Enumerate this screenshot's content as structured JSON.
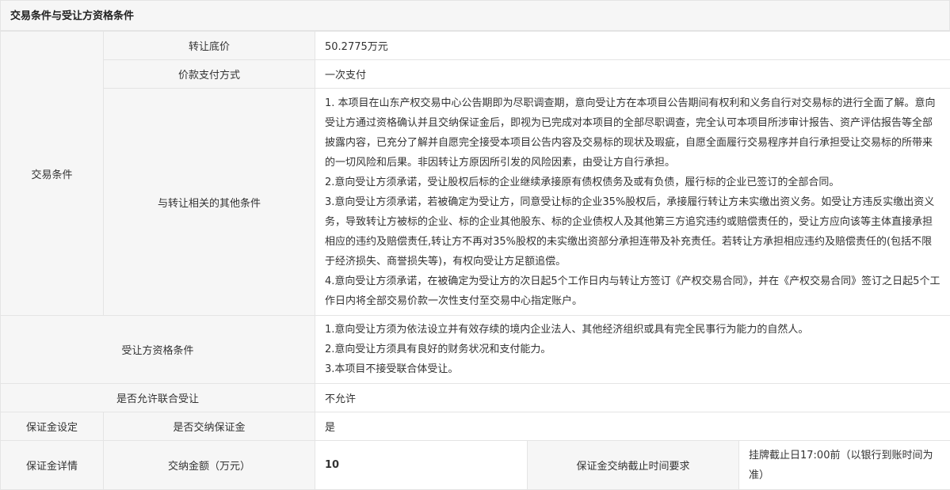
{
  "section_title": "交易条件与受让方资格条件",
  "trade": {
    "group_label": "交易条件",
    "price_label": "转让底价",
    "price_value": "50.2775万元",
    "payment_label": "价款支付方式",
    "payment_value": "一次支付",
    "other_label": "与转让相关的其他条件",
    "other_paragraphs": [
      "1. 本项目在山东产权交易中心公告期即为尽职调查期，意向受让方在本项目公告期间有权利和义务自行对交易标的进行全面了解。意向受让方通过资格确认并且交纳保证金后，即视为已完成对本项目的全部尽职调查，完全认可本项目所涉审计报告、资产评估报告等全部披露内容，已充分了解并自愿完全接受本项目公告内容及交易标的现状及瑕疵，自愿全面履行交易程序并自行承担受让交易标的所带来的一切风险和后果。非因转让方原因所引发的风险因素，由受让方自行承担。",
      "2.意向受让方须承诺，受让股权后标的企业继续承接原有债权债务及或有负债，履行标的企业已签订的全部合同。",
      "3.意向受让方须承诺，若被确定为受让方，同意受让标的企业35%股权后，承接履行转让方未实缴出资义务。如受让方违反实缴出资义务，导致转让方被标的企业、标的企业其他股东、标的企业债权人及其他第三方追究违约或赔偿责任的，受让方应向该等主体直接承担相应的违约及赔偿责任,转让方不再对35%股权的未实缴出资部分承担连带及补充责任。若转让方承担相应违约及赔偿责任的(包括不限于经济损失、商誉损失等)，有权向受让方足额追偿。",
      "4.意向受让方须承诺，在被确定为受让方的次日起5个工作日内与转让方签订《产权交易合同》，并在《产权交易合同》签订之日起5个工作日内将全部交易价款一次性支付至交易中心指定账户。"
    ]
  },
  "qualification": {
    "label": "受让方资格条件",
    "paragraphs": [
      "1.意向受让方须为依法设立并有效存续的境内企业法人、其他经济组织或具有完全民事行为能力的自然人。",
      "2.意向受让方须具有良好的财务状况和支付能力。",
      "3.本项目不接受联合体受让。"
    ]
  },
  "joint": {
    "label": "是否允许联合受让",
    "value": "不允许"
  },
  "deposit_setting": {
    "group_label": "保证金设定",
    "label": "是否交纳保证金",
    "value": "是"
  },
  "deposit_detail": {
    "group_label": "保证金详情",
    "amount_label": "交纳金额（万元）",
    "amount_value": "10",
    "deadline_label": "保证金交纳截止时间要求",
    "deadline_value": "挂牌截止日17:00前（以银行到账时间为准）"
  }
}
